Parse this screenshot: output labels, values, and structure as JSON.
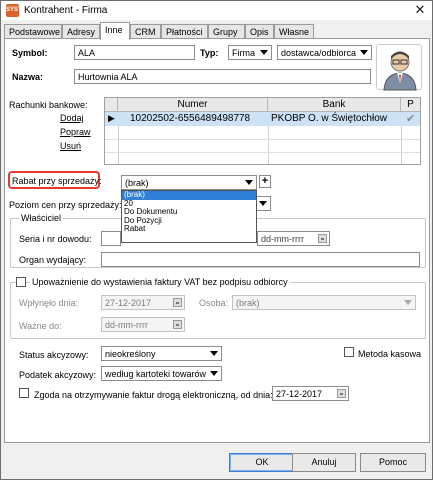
{
  "window": {
    "title": "Kontrahent - Firma",
    "app_icon_text": "SYST"
  },
  "tabs": [
    "Podstawowe",
    "Adresy",
    "Inne",
    "CRM",
    "Płatności",
    "Grupy",
    "Opis",
    "Własne"
  ],
  "header": {
    "symbol_label": "Symbol:",
    "symbol_value": "ALA",
    "type_label": "Typ:",
    "type_value": "Firma",
    "role_value": "dostawca/odbiorca",
    "name_label": "Nazwa:",
    "name_value": "Hurtownia ALA"
  },
  "bank": {
    "label": "Rachunki bankowe:",
    "add_link": "Dodaj",
    "edit_link": "Popraw",
    "delete_link": "Usuń",
    "columns": [
      "Numer",
      "Bank",
      "P"
    ],
    "rows": [
      {
        "number": "10202502-6556489498778",
        "bank": "PKOBP O. w Świętochłow",
        "p": "✔"
      }
    ]
  },
  "discount": {
    "label": "Rabat przy sprzedaży:",
    "value": "(brak)",
    "options": [
      "(brak)",
      "20",
      "Do Dokumentu",
      "Do Pozycji",
      "Rabat"
    ],
    "selected_index": 0
  },
  "price_level": {
    "label": "Poziom cen przy sprzedaży:"
  },
  "owner": {
    "group_label": "Właściciel",
    "id_label": "Seria i nr dowodu:",
    "date_placeholder": "dd-mm-rrrr",
    "issuer_label": "Organ wydający:"
  },
  "vat_auth": {
    "checkbox_label": "Upoważnienie do wystawienia faktury VAT bez podpisu odbiorcy",
    "received_label": "Wpłynęło dnia:",
    "received_value": "27-12-2017",
    "person_label": "Osoba:",
    "person_value": "(brak)",
    "valid_label": "Ważne do:",
    "valid_value": "dd-mm-rrrr"
  },
  "excise": {
    "status_label": "Status akcyzowy:",
    "status_value": "nieokreślony",
    "cash_method_label": "Metoda kasowa",
    "tax_label": "Podatek akcyzowy:",
    "tax_value": "według kartoteki towarów"
  },
  "einvoice": {
    "label": "Zgoda na otrzymywanie faktur drogą elektroniczną, od dnia:",
    "date": "27-12-2017"
  },
  "buttons": {
    "ok": "OK",
    "cancel": "Anuluj",
    "help": "Pomoc"
  }
}
